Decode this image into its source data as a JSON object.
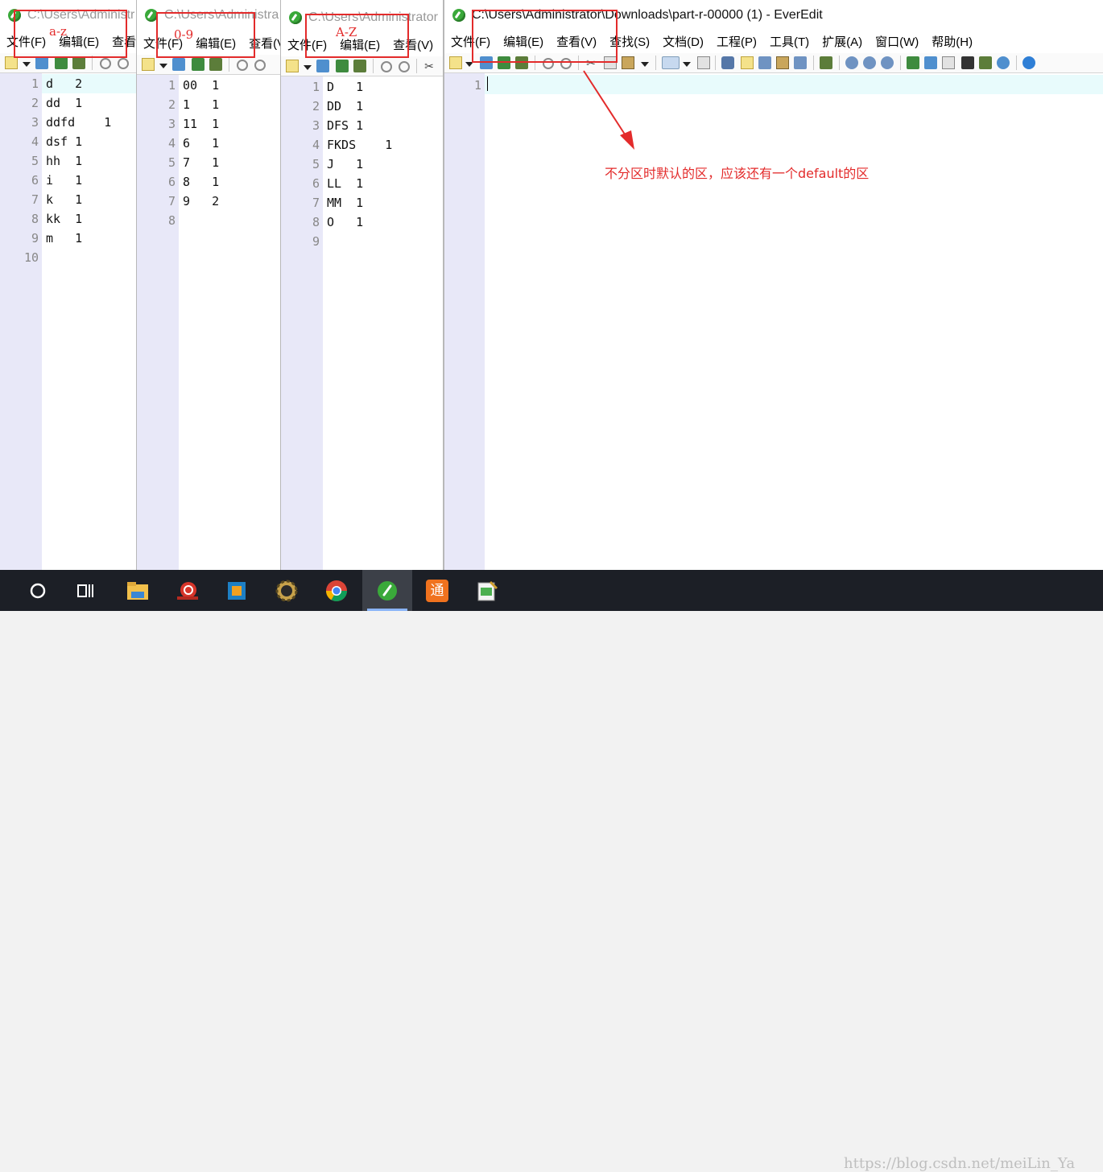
{
  "windows": [
    {
      "id": "win1",
      "title": "C:\\Users\\Administr",
      "menu": [
        "文件(F)",
        "编辑(E)",
        "查看("
      ],
      "lines": [
        "d   2",
        "dd  1",
        "ddfd    1",
        "dsf 1",
        "hh  1",
        "i   1",
        "k   1",
        "kk  1",
        "m   1",
        ""
      ],
      "line_numbers": [
        "1",
        "2",
        "3",
        "4",
        "5",
        "6",
        "7",
        "8",
        "9",
        "10"
      ],
      "annotation_label": "a-z"
    },
    {
      "id": "win2",
      "title": "C:\\Users\\Administra",
      "menu": [
        "文件(F)",
        "编辑(E)",
        "查看(V"
      ],
      "lines": [
        "00  1",
        "1   1",
        "11  1",
        "6   1",
        "7   1",
        "8   1",
        "9   2",
        ""
      ],
      "line_numbers": [
        "1",
        "2",
        "3",
        "4",
        "5",
        "6",
        "7",
        "8"
      ],
      "annotation_label": "0-9"
    },
    {
      "id": "win3",
      "title": "C:\\Users\\Administrator",
      "menu": [
        "文件(F)",
        "编辑(E)",
        "查看(V)"
      ],
      "lines": [
        "D   1",
        "DD  1",
        "DFS 1",
        "FKDS    1",
        "J   1",
        "LL  1",
        "MM  1",
        "O   1",
        ""
      ],
      "line_numbers": [
        "1",
        "2",
        "3",
        "4",
        "5",
        "6",
        "7",
        "8",
        "9"
      ],
      "annotation_label": "A-Z"
    },
    {
      "id": "win4",
      "title": "C:\\Users\\Administrator\\Downloads\\part-r-00000 (1) - EverEdit",
      "menu": [
        "文件(F)",
        "编辑(E)",
        "查看(V)",
        "查找(S)",
        "文档(D)",
        "工程(P)",
        "工具(T)",
        "扩展(A)",
        "窗口(W)",
        "帮助(H)"
      ],
      "lines": [
        ""
      ],
      "line_numbers": [
        "1"
      ]
    }
  ],
  "annotation_note": "不分区时默认的区，应该还有一个default的区",
  "annotation_color": "#e32b2b",
  "watermark": "https://blog.csdn.net/meiLin_Ya",
  "taskbar": {
    "items": [
      "search-circle-icon",
      "task-view-icon",
      "file-explorer-icon",
      "snail-app-icon",
      "virtualbox-icon",
      "settings-gear-app-icon",
      "chrome-icon",
      "everedit-icon",
      "tong-app-icon",
      "notepad-app-icon"
    ],
    "active_item": "everedit-icon",
    "tong_label": "通"
  }
}
